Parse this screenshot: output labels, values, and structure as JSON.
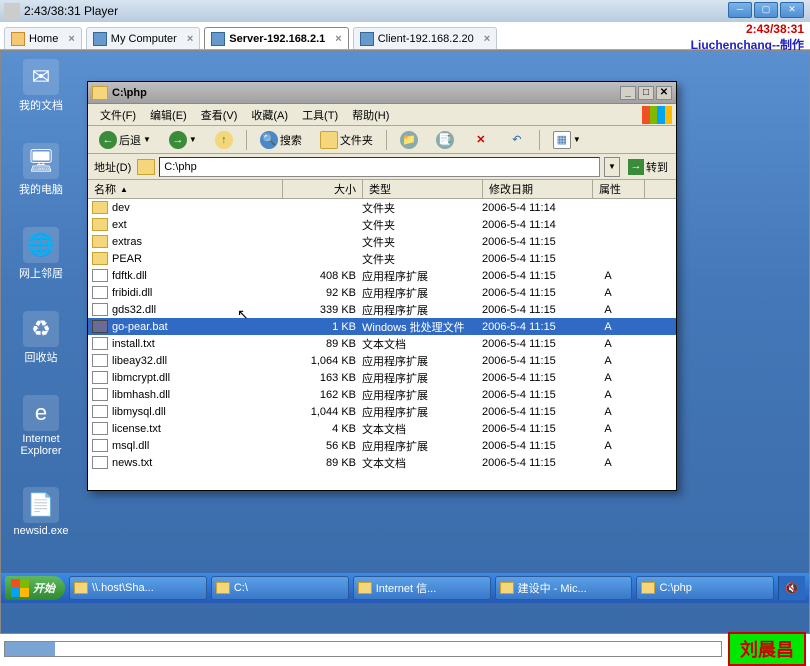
{
  "player": {
    "title": "2:43/38:31 Player",
    "time": "2:43/38:31",
    "credit": "Liuchenchang--制作"
  },
  "tabs": [
    {
      "label": "Home",
      "icon": "home"
    },
    {
      "label": "My Computer",
      "icon": "pc"
    },
    {
      "label": "Server-192.168.2.1",
      "icon": "pc",
      "active": true
    },
    {
      "label": "Client-192.168.2.20",
      "icon": "pc"
    }
  ],
  "desktop_icons": [
    {
      "label": "我的文档",
      "glyph": "✉"
    },
    {
      "label": "我的电脑",
      "glyph": "🖥"
    },
    {
      "label": "网上邻居",
      "glyph": "🌐"
    },
    {
      "label": "回收站",
      "glyph": "♻"
    },
    {
      "label": "Internet Explorer",
      "glyph": "e"
    },
    {
      "label": "newsid.exe",
      "glyph": "📄"
    }
  ],
  "explorer": {
    "title": "C:\\php",
    "menus": [
      "文件(F)",
      "编辑(E)",
      "查看(V)",
      "收藏(A)",
      "工具(T)",
      "帮助(H)"
    ],
    "toolbar": {
      "back": "后退",
      "search": "搜索",
      "folders": "文件夹"
    },
    "address": {
      "label": "地址(D)",
      "value": "C:\\php",
      "go": "转到"
    },
    "columns": {
      "name": "名称",
      "size": "大小",
      "type": "类型",
      "date": "修改日期",
      "attr": "属性"
    },
    "files": [
      {
        "name": "dev",
        "size": "",
        "type": "文件夹",
        "date": "2006-5-4 11:14",
        "attr": "",
        "icon": "folder"
      },
      {
        "name": "ext",
        "size": "",
        "type": "文件夹",
        "date": "2006-5-4 11:14",
        "attr": "",
        "icon": "folder"
      },
      {
        "name": "extras",
        "size": "",
        "type": "文件夹",
        "date": "2006-5-4 11:15",
        "attr": "",
        "icon": "folder"
      },
      {
        "name": "PEAR",
        "size": "",
        "type": "文件夹",
        "date": "2006-5-4 11:15",
        "attr": "",
        "icon": "folder"
      },
      {
        "name": "fdftk.dll",
        "size": "408 KB",
        "type": "应用程序扩展",
        "date": "2006-5-4 11:15",
        "attr": "A",
        "icon": "file"
      },
      {
        "name": "fribidi.dll",
        "size": "92 KB",
        "type": "应用程序扩展",
        "date": "2006-5-4 11:15",
        "attr": "A",
        "icon": "file"
      },
      {
        "name": "gds32.dll",
        "size": "339 KB",
        "type": "应用程序扩展",
        "date": "2006-5-4 11:15",
        "attr": "A",
        "icon": "file"
      },
      {
        "name": "go-pear.bat",
        "size": "1 KB",
        "type": "Windows 批处理文件",
        "date": "2006-5-4 11:15",
        "attr": "A",
        "icon": "bat",
        "selected": true
      },
      {
        "name": "install.txt",
        "size": "89 KB",
        "type": "文本文档",
        "date": "2006-5-4 11:15",
        "attr": "A",
        "icon": "file"
      },
      {
        "name": "libeay32.dll",
        "size": "1,064 KB",
        "type": "应用程序扩展",
        "date": "2006-5-4 11:15",
        "attr": "A",
        "icon": "file"
      },
      {
        "name": "libmcrypt.dll",
        "size": "163 KB",
        "type": "应用程序扩展",
        "date": "2006-5-4 11:15",
        "attr": "A",
        "icon": "file"
      },
      {
        "name": "libmhash.dll",
        "size": "162 KB",
        "type": "应用程序扩展",
        "date": "2006-5-4 11:15",
        "attr": "A",
        "icon": "file"
      },
      {
        "name": "libmysql.dll",
        "size": "1,044 KB",
        "type": "应用程序扩展",
        "date": "2006-5-4 11:15",
        "attr": "A",
        "icon": "file"
      },
      {
        "name": "license.txt",
        "size": "4 KB",
        "type": "文本文档",
        "date": "2006-5-4 11:15",
        "attr": "A",
        "icon": "file"
      },
      {
        "name": "msql.dll",
        "size": "56 KB",
        "type": "应用程序扩展",
        "date": "2006-5-4 11:15",
        "attr": "A",
        "icon": "file"
      },
      {
        "name": "news.txt",
        "size": "89 KB",
        "type": "文本文档",
        "date": "2006-5-4 11:15",
        "attr": "A",
        "icon": "file"
      }
    ]
  },
  "taskbar": {
    "start": "开始",
    "buttons": [
      "\\\\.host\\Sha...",
      "C:\\",
      "Internet 信...",
      "建设中 - Mic...",
      "C:\\php"
    ]
  },
  "stamp": "刘晨昌"
}
